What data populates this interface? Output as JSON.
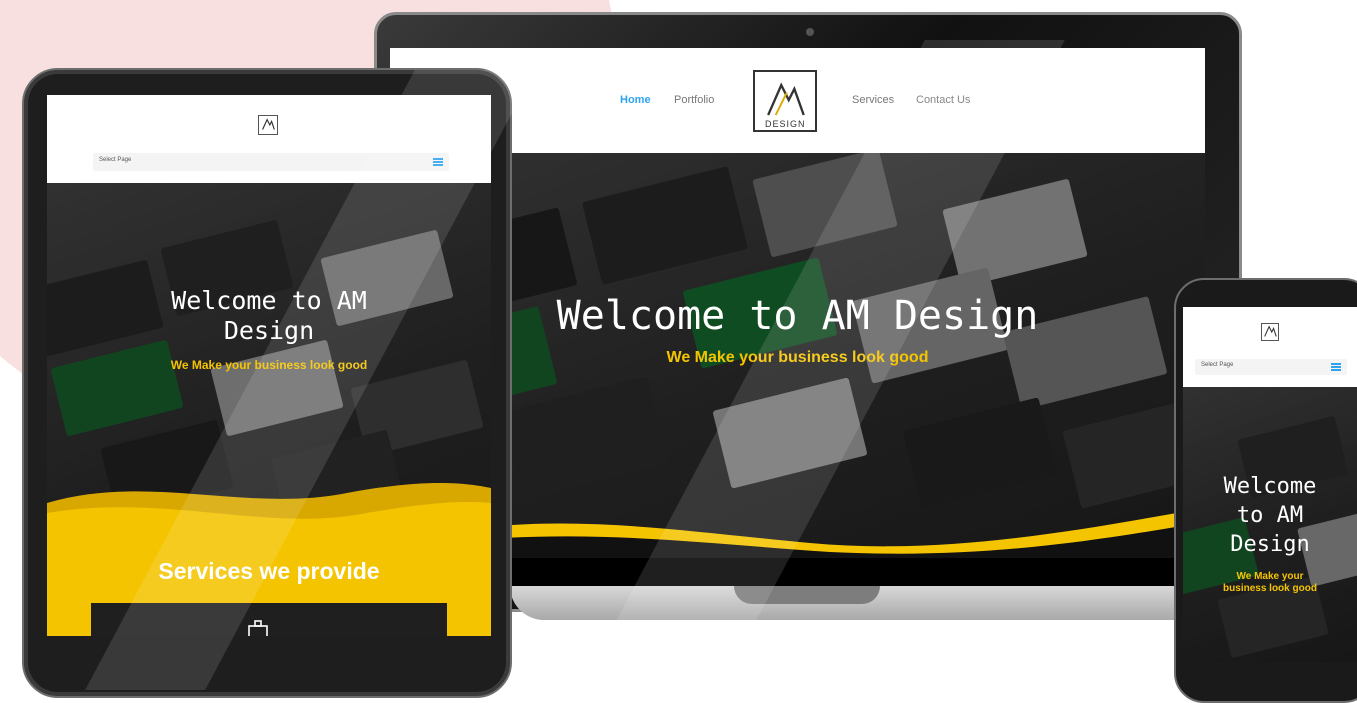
{
  "colors": {
    "accent_blue": "#2ea3f2",
    "accent_yellow": "#f5c400",
    "pink": "#f8dfe0",
    "dark": "#1e1e1e"
  },
  "laptop": {
    "nav": {
      "home": "Home",
      "portfolio": "Portfolio",
      "services": "Services",
      "contact": "Contact Us"
    },
    "logo_caption": "DESIGN",
    "hero_title": "Welcome to AM Design",
    "hero_subtitle": "We Make your business look good"
  },
  "tablet": {
    "select_page": "Select Page",
    "hero_title_line1": "Welcome to AM",
    "hero_title_line2": "Design",
    "hero_subtitle": "We Make your business look good",
    "services_title": "Services we provide"
  },
  "phone": {
    "select_page": "Select Page",
    "hero_title_line1": "Welcome",
    "hero_title_line2": "to AM",
    "hero_title_line3": "Design",
    "hero_subtitle_line1": "We Make your",
    "hero_subtitle_line2": "business look good"
  },
  "icons": [
    "logo-am-icon",
    "hamburger-menu-icon",
    "briefcase-icon"
  ]
}
